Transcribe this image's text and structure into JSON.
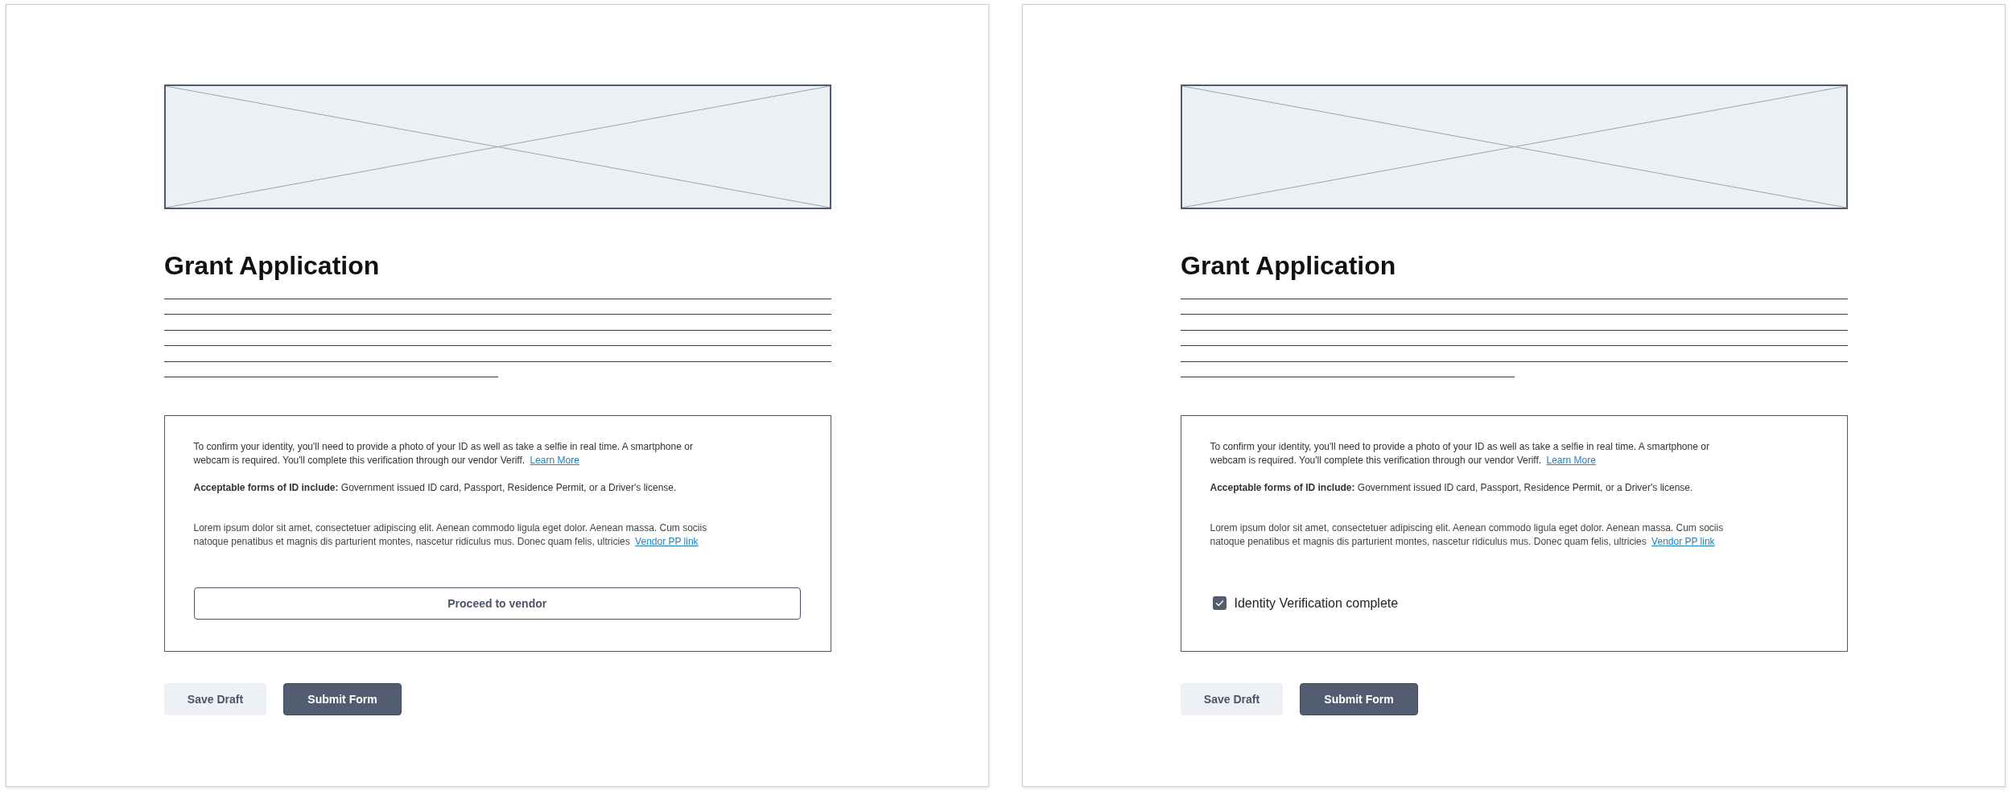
{
  "panels": [
    {
      "title": "Grant Application",
      "verification": {
        "intro": "To confirm your identity, you'll need to provide a photo of your ID as well as take a selfie in real time. A smartphone or webcam is required. You'll complete this verification through our vendor Veriff.",
        "intro_link": "Learn More",
        "id_forms": "**Acceptable forms of ID include:** Government issued ID card, Passport, Residence Permit, or a Driver's license.",
        "body": "Lorem ipsum dolor sit amet, consectetuer adipiscing elit. Aenean commodo ligula eget dolor. Aenean massa. Cum sociis natoque penatibus et magnis dis parturient montes, nascetur ridiculus mus. Donec quam felis, ultricies",
        "body_link": "Vendor PP link",
        "action": {
          "kind": "button",
          "label": "Proceed to vendor"
        }
      },
      "buttons": [
        {
          "kind": "secondary",
          "label": "Save Draft"
        },
        {
          "kind": "primary",
          "label": "Submit Form"
        }
      ]
    },
    {
      "title": "Grant Application",
      "verification": {
        "intro": "To confirm your identity, you'll need to provide a photo of your ID as well as take a selfie in real time. A smartphone or webcam is required. You'll complete this verification through our vendor Veriff.",
        "intro_link": "Learn More",
        "id_forms": "**Acceptable forms of ID include:** Government issued ID card, Passport, Residence Permit, or a Driver's license.",
        "body": "Lorem ipsum dolor sit amet, consectetuer adipiscing elit. Aenean commodo ligula eget dolor. Aenean massa. Cum sociis natoque penatibus et magnis dis parturient montes, nascetur ridiculus mus. Donec quam felis, ultricies",
        "body_link": "Vendor PP link",
        "action": {
          "kind": "checkbox",
          "label": "Identity Verification complete",
          "checked": true
        }
      },
      "buttons": [
        {
          "kind": "secondary",
          "label": "Save Draft"
        },
        {
          "kind": "primary",
          "label": "Submit Form"
        }
      ]
    }
  ]
}
